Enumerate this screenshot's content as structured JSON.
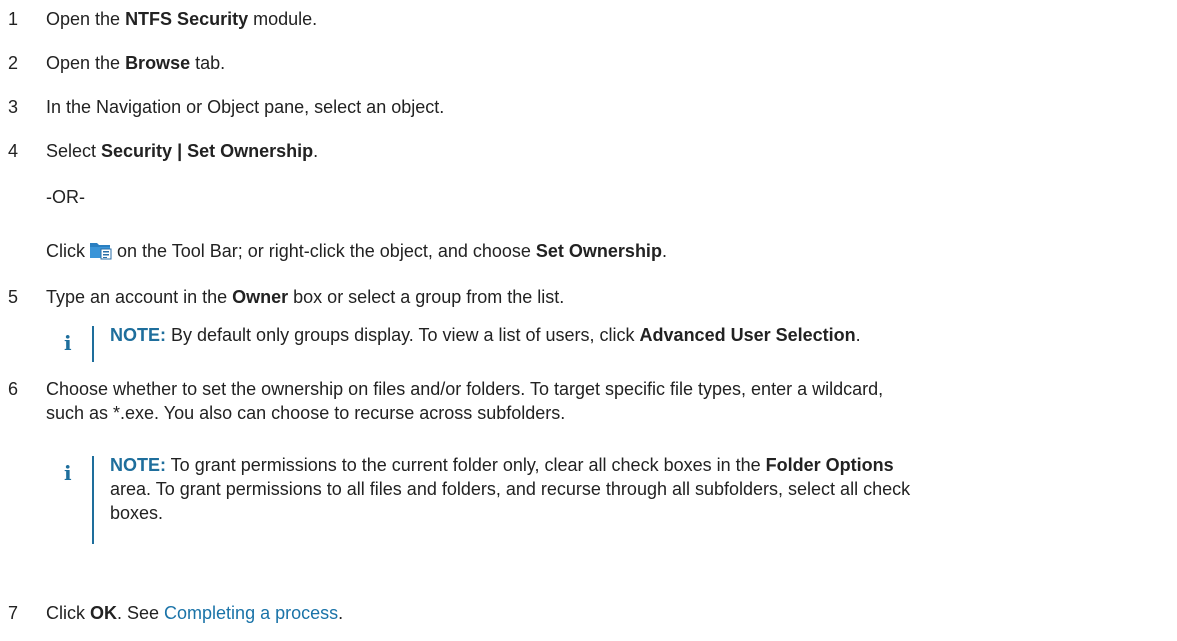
{
  "steps": [
    {
      "num": "1",
      "pre": "Open the ",
      "bold": "NTFS Security",
      "post": " module."
    },
    {
      "num": "2",
      "pre": "Open the ",
      "bold": "Browse",
      "post": " tab."
    },
    {
      "num": "3",
      "text": "In the Navigation or Object pane, select an object."
    },
    {
      "num": "4",
      "pre": "Select ",
      "bold": "Security | Set Ownership",
      "post": "."
    },
    {
      "num": "5",
      "pre": "Type an account in the ",
      "bold": "Owner",
      "post": " box or select a group from the list."
    },
    {
      "num": "6",
      "line1": "Choose whether to set the ownership on files and/or folders. To target specific file types, enter a wildcard,",
      "line2": "such as *.exe. You also can choose to recurse across subfolders."
    },
    {
      "num": "7",
      "pre": "Click ",
      "bold": "OK",
      "mid": ". See ",
      "link": "Completing a process",
      "post": "."
    }
  ],
  "or_text": "-OR-",
  "click_line": {
    "pre": "Click",
    "mid": "on the Tool Bar; or right-click the object, and choose ",
    "bold": "Set Ownership",
    "post": ".",
    "icon": "folder-ownership-icon"
  },
  "note1": {
    "label": "NOTE:",
    "pre": " By default only groups display. To view a list of users, click ",
    "bold": "Advanced User Selection",
    "post": "."
  },
  "note2": {
    "label": "NOTE:",
    "line1_pre": " To grant permissions to the current folder only, clear all check boxes in the ",
    "line1_bold": "Folder Options",
    "line2": "area. To grant permissions to all files and folders, and recurse through all subfolders, select all check",
    "line3": "boxes."
  },
  "note_icon_glyph": "i",
  "colors": {
    "accent": "#1e6e9c",
    "link": "#1a73a8",
    "text": "#222222"
  }
}
